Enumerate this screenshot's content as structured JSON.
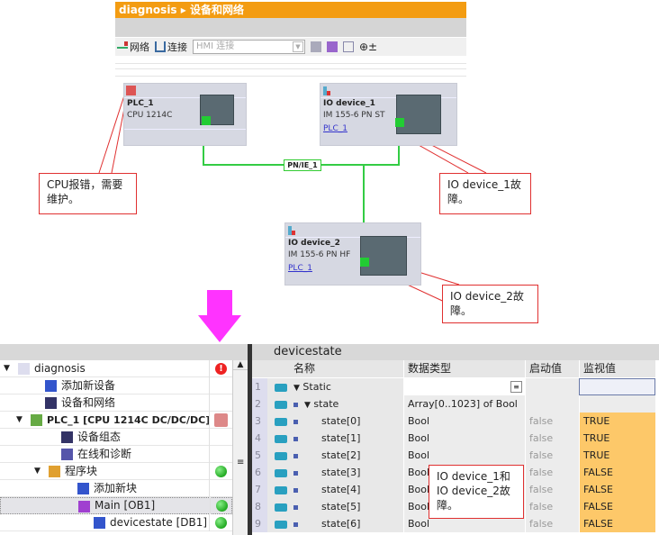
{
  "breadcrumb": {
    "project": "diagnosis",
    "separator": "▸",
    "page": "设备和网络"
  },
  "toolbar": {
    "network": "网络",
    "connections": "连接",
    "hmi_select": "HMI 连接"
  },
  "network": {
    "devices": [
      {
        "name": "PLC_1",
        "model": "CPU 1214C",
        "link": ""
      },
      {
        "name": "IO device_1",
        "model": "IM 155-6 PN ST",
        "link": "PLC_1"
      },
      {
        "name": "IO device_2",
        "model": "IM 155-6 PN HF",
        "link": "PLC_1"
      }
    ],
    "subnet": "PN/IE_1"
  },
  "callouts": {
    "cpu": "CPU报错，需要维护。",
    "dev1": "IO device_1故障。",
    "dev2": "IO device_2故障。",
    "table": "IO device_1和IO device_2故障。"
  },
  "tree": {
    "items": [
      {
        "label": "diagnosis",
        "status": "error"
      },
      {
        "label": "添加新设备",
        "status": ""
      },
      {
        "label": "设备和网络",
        "status": ""
      },
      {
        "label": "PLC_1 [CPU 1214C DC/DC/DC]",
        "status": "maintenance"
      },
      {
        "label": "设备组态",
        "status": ""
      },
      {
        "label": "在线和诊断",
        "status": ""
      },
      {
        "label": "程序块",
        "status": "ok"
      },
      {
        "label": "添加新块",
        "status": ""
      },
      {
        "label": "Main [OB1]",
        "status": "ok"
      },
      {
        "label": "devicestate [DB1]",
        "status": "ok"
      }
    ]
  },
  "table": {
    "title": "devicestate",
    "headers": [
      "名称",
      "数据类型",
      "启动值",
      "监视值"
    ],
    "rows": [
      {
        "n": "1",
        "name": "Static",
        "type": "",
        "start": "",
        "mon": ""
      },
      {
        "n": "2",
        "name": "state",
        "type": "Array[0..1023] of Bool",
        "start": "",
        "mon": ""
      },
      {
        "n": "3",
        "name": "state[0]",
        "type": "Bool",
        "start": "false",
        "mon": "TRUE"
      },
      {
        "n": "4",
        "name": "state[1]",
        "type": "Bool",
        "start": "false",
        "mon": "TRUE"
      },
      {
        "n": "5",
        "name": "state[2]",
        "type": "Bool",
        "start": "false",
        "mon": "TRUE"
      },
      {
        "n": "6",
        "name": "state[3]",
        "type": "Bool",
        "start": "false",
        "mon": "FALSE"
      },
      {
        "n": "7",
        "name": "state[4]",
        "type": "Bool",
        "start": "false",
        "mon": "FALSE"
      },
      {
        "n": "8",
        "name": "state[5]",
        "type": "Bool",
        "start": "false",
        "mon": "FALSE"
      },
      {
        "n": "9",
        "name": "state[6]",
        "type": "Bool",
        "start": "false",
        "mon": "FALSE"
      }
    ]
  },
  "colors": {
    "accent": "#f39c12",
    "monitor": "#fdc869",
    "callout_border": "#e03030",
    "link": "#22cc33",
    "arrow": "#ff33ff"
  }
}
